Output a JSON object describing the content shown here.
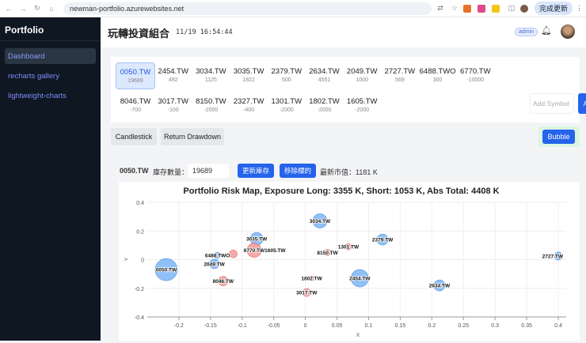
{
  "browser": {
    "url": "newman-portfolio.azurewebsites.net",
    "update_label": "完成更新"
  },
  "sidebar": {
    "brand": "Portfolio",
    "items": [
      {
        "label": "Dashboard"
      },
      {
        "label": "recharts gallery"
      },
      {
        "label": "lightweight-charts"
      }
    ]
  },
  "header": {
    "title": "玩轉投資組合",
    "time": "11/19 16:54:44",
    "badge": "admin"
  },
  "symbols": [
    {
      "name": "0050.TW",
      "qty": "19689"
    },
    {
      "name": "2454.TW",
      "qty": "492"
    },
    {
      "name": "3034.TW",
      "qty": "1125"
    },
    {
      "name": "3035.TW",
      "qty": "1822"
    },
    {
      "name": "2379.TW",
      "qty": "500"
    },
    {
      "name": "2634.TW",
      "qty": "4551"
    },
    {
      "name": "2049.TW",
      "qty": "1000"
    },
    {
      "name": "2727.TW",
      "qty": "569"
    },
    {
      "name": "6488.TWO",
      "qty": "300"
    },
    {
      "name": "6770.TW",
      "qty": "-10000"
    },
    {
      "name": "8046.TW",
      "qty": "-700"
    },
    {
      "name": "3017.TW",
      "qty": "-100"
    },
    {
      "name": "8150.TW",
      "qty": "-2000"
    },
    {
      "name": "2327.TW",
      "qty": "-400"
    },
    {
      "name": "1301.TW",
      "qty": "-2000"
    },
    {
      "name": "1802.TW",
      "qty": "-2000"
    },
    {
      "name": "1605.TW",
      "qty": "-2000"
    }
  ],
  "add_symbol": {
    "placeholder": "Add Symbol",
    "button": "Add"
  },
  "view_buttons": {
    "candlestick": "Candlestick",
    "return_drawdown": "Return Drawdown",
    "bubble": "Bubble"
  },
  "detail": {
    "symbol": "0050.TW",
    "qty_label": "庫存數量：",
    "qty_value": "19689",
    "update_button": "更新庫存",
    "remove_button": "移除標的",
    "market_value": "最新市值：1181 K"
  },
  "chart_data": {
    "type": "scatter",
    "title": "Portfolio Risk Map, Exposure Long: 3355 K, Short: 1053 K, Abs Total: 4408 K",
    "xlabel": "X",
    "ylabel": "Y",
    "xlim": [
      -0.25,
      0.4125
    ],
    "ylim": [
      -0.4,
      0.4
    ],
    "xticks": [
      -0.2,
      -0.15,
      -0.1,
      -0.05,
      0,
      0.05,
      0.1,
      0.15,
      0.2,
      0.25,
      0.3,
      0.35,
      0.4
    ],
    "yticks": [
      0.4,
      0.2,
      0,
      -0.2,
      -0.4
    ],
    "colors": {
      "long": "#7cb5f5",
      "short": "#f59a9a",
      "long_stroke": "#4a90e2",
      "short_stroke": "#e06b6b"
    },
    "points": [
      {
        "label": "0050.TW",
        "x": -0.22,
        "y": -0.07,
        "z": 1181,
        "side": "long"
      },
      {
        "label": "3034.TW",
        "x": 0.023,
        "y": 0.27,
        "z": 488,
        "side": "long"
      },
      {
        "label": "3035.TW",
        "x": -0.077,
        "y": 0.145,
        "z": 386,
        "side": "long"
      },
      {
        "label": "2379.TW",
        "x": 0.122,
        "y": 0.14,
        "z": 295,
        "side": "long"
      },
      {
        "label": "2454.TW",
        "x": 0.086,
        "y": -0.13,
        "z": 730,
        "side": "long"
      },
      {
        "label": "2634.TW",
        "x": 0.212,
        "y": -0.18,
        "z": 295,
        "side": "long"
      },
      {
        "label": "2727.TW",
        "x": 0.4,
        "y": 0.025,
        "z": 150,
        "side": "long"
      },
      {
        "label": "6488.TWO",
        "x": -0.139,
        "y": 0.03,
        "z": 96,
        "side": "long"
      },
      {
        "label": "2049.TW",
        "x": -0.144,
        "y": -0.03,
        "z": 217,
        "side": "long"
      },
      {
        "label": "6770.TW",
        "x": -0.081,
        "y": 0.065,
        "z": 488,
        "side": "short"
      },
      {
        "label": "8046.TW",
        "x": -0.13,
        "y": -0.15,
        "z": 217,
        "side": "short"
      },
      {
        "label": "1605.TW",
        "x": -0.048,
        "y": 0.065,
        "z": 24,
        "side": "short"
      },
      {
        "label": "3017.TW",
        "x": 0.002,
        "y": -0.23,
        "z": 150,
        "side": "short"
      },
      {
        "label": "8150.TW",
        "x": 0.035,
        "y": 0.05,
        "z": 96,
        "side": "short"
      },
      {
        "label": "1301.TW",
        "x": 0.068,
        "y": 0.09,
        "z": 96,
        "side": "short"
      },
      {
        "label": "1802.TW",
        "x": 0.01,
        "y": -0.13,
        "z": 54,
        "side": "short"
      },
      {
        "x": -0.114,
        "y": 0.04,
        "z": 150,
        "side": "short"
      }
    ]
  }
}
